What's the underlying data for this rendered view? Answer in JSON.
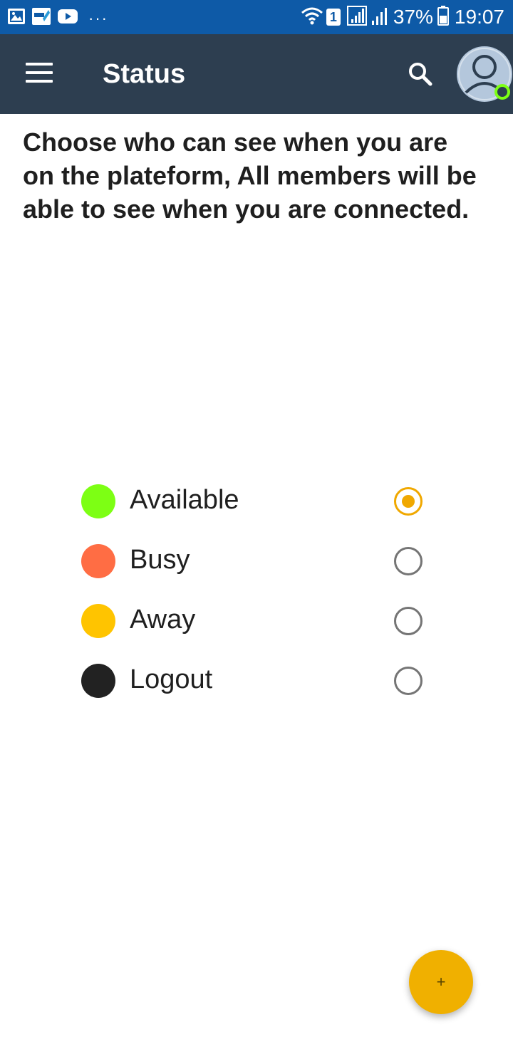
{
  "status_bar": {
    "notification_icons": [
      "gallery-icon",
      "app-notification-icon",
      "youtube-icon"
    ],
    "more_indicator": "···",
    "sim_slot": "1",
    "battery_percent": "37%",
    "time": "19:07"
  },
  "app_bar": {
    "title": "Status",
    "menu_icon": "hamburger-menu-icon",
    "search_icon": "search-icon",
    "avatar_icon": "user-avatar-icon"
  },
  "intro_text": "Choose who can see when you are on the plateform, All members will be able to see when you are connected.",
  "status_options": [
    {
      "label": "Available",
      "color": "#7dff14",
      "selected": true
    },
    {
      "label": "Busy",
      "color": "#ff6d44",
      "selected": false
    },
    {
      "label": "Away",
      "color": "#ffc400",
      "selected": false
    },
    {
      "label": "Logout",
      "color": "#222222",
      "selected": false
    }
  ],
  "fab": {
    "label": "+",
    "color": "#f0b000"
  },
  "colors": {
    "status_bar": "#0e5aa7",
    "app_bar": "#2d3e50",
    "accent": "#f0a800",
    "online_indicator": "#7dff14"
  }
}
